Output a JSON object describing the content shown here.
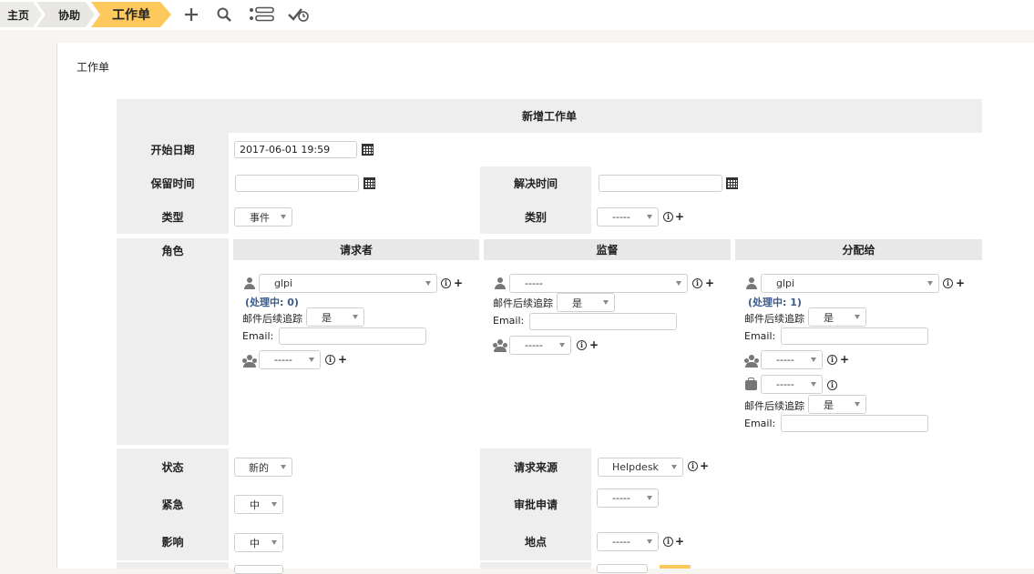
{
  "breadcrumb": {
    "home": "主页",
    "assist": "协助",
    "current": "工作单"
  },
  "toolbar": {
    "add_icon": "plus-icon",
    "search_icon": "search-icon",
    "list_icon": "list-icon",
    "check_icon": "check-clock-icon"
  },
  "page_title": "工作单",
  "form": {
    "heading": "新增工作单",
    "start_date": {
      "label": "开始日期",
      "value": "2017-06-01 19:59"
    },
    "due_date": {
      "label": "保留时间",
      "value": ""
    },
    "solve_date": {
      "label": "解决时间",
      "value": ""
    },
    "type": {
      "label": "类型",
      "value": "事件"
    },
    "category": {
      "label": "类别",
      "value": "-----"
    },
    "roles": {
      "label": "角色",
      "requester": {
        "title": "请求者",
        "user": "glpi",
        "count": "(处理中: 0)",
        "followup_label": "邮件后续追踪",
        "followup_value": "是",
        "email_label": "Email:",
        "group": "-----"
      },
      "watcher": {
        "title": "监督",
        "user": "-----",
        "followup_label": "邮件后续追踪",
        "followup_value": "是",
        "email_label": "Email:",
        "group": "-----"
      },
      "assigned": {
        "title": "分配给",
        "user": "glpi",
        "count": "(处理中: 1)",
        "followup_label": "邮件后续追踪",
        "followup_value": "是",
        "email_label": "Email:",
        "group": "-----",
        "supplier": "-----",
        "followup2_label": "邮件后续追踪",
        "followup2_value": "是",
        "email2_label": "Email:"
      }
    },
    "status": {
      "label": "状态",
      "value": "新的"
    },
    "source": {
      "label": "请求来源",
      "value": "Helpdesk"
    },
    "urgency": {
      "label": "紧急",
      "value": "中"
    },
    "approval": {
      "label": "审批申请",
      "value": "-----"
    },
    "impact": {
      "label": "影响",
      "value": "中"
    },
    "location": {
      "label": "地点",
      "value": "-----"
    }
  },
  "colors": {
    "accent": "#fec95c",
    "label_bg": "#eeeeee",
    "page_bg": "#f6f5f2",
    "link": "#3a5a8c"
  }
}
